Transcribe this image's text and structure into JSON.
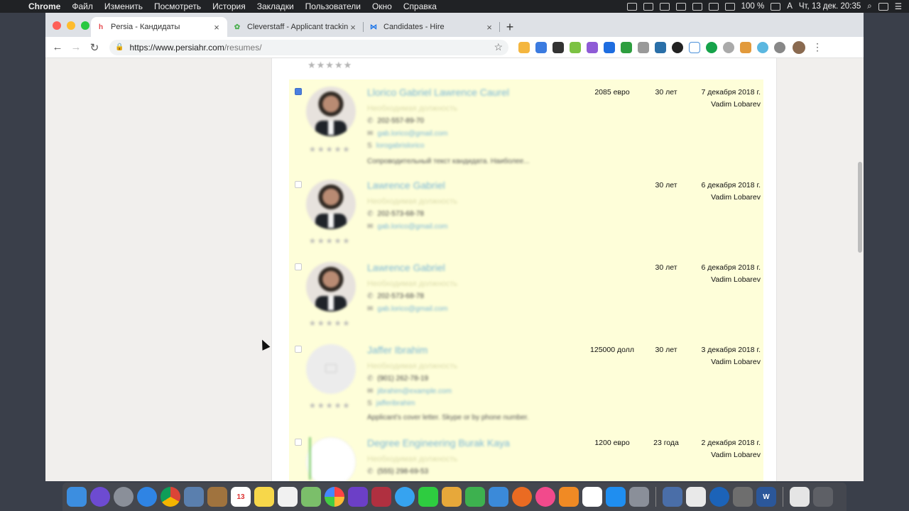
{
  "menubar": {
    "app": "Chrome",
    "items": [
      "Файл",
      "Изменить",
      "Посмотреть",
      "История",
      "Закладки",
      "Пользователи",
      "Окно",
      "Справка"
    ],
    "battery": "100 %",
    "input_lang": "A",
    "clock": "Чт, 13 дек.  20:35"
  },
  "tabs": [
    {
      "title": "Persia - Кандидаты",
      "favicon": "persia-logo-icon",
      "color": "#e5484d"
    },
    {
      "title": "Cleverstaff - Applicant tracking",
      "favicon": "cleverstaff-logo-icon",
      "color": "#4caf50"
    },
    {
      "title": "Candidates - Hire",
      "favicon": "hire-logo-icon",
      "color": "#1a73e8"
    }
  ],
  "address": {
    "url_host": "https://www.persiahr.com",
    "url_path": "/resumes/"
  },
  "candidates": [
    {
      "name": "Llorico Gabriel Lawrence Caurel",
      "position": "Необходимая должность",
      "phone": "202-557-89-70",
      "email": "gab.lorico@gmail.com",
      "link": "lorogabrislorico",
      "note": "Сопроводительный текст кандидата. Наиболее...",
      "salary": "2085 евро",
      "age": "30 лет",
      "date": "7 декабря 2018 г.",
      "author": "Vadim Lobarev",
      "checked": true,
      "photo": "portrait"
    },
    {
      "name": "Lawrence Gabriel",
      "position": "Необходимая должность",
      "phone": "202-573-68-78",
      "email": "gab.lorico@gmail.com",
      "link": "",
      "note": "",
      "salary": "",
      "age": "30 лет",
      "date": "6 декабря 2018 г.",
      "author": "Vadim Lobarev",
      "checked": false,
      "photo": "portrait"
    },
    {
      "name": "Lawrence Gabriel",
      "position": "Необходимая должность",
      "phone": "202-573-68-78",
      "email": "gab.lorico@gmail.com",
      "link": "",
      "note": "",
      "salary": "",
      "age": "30 лет",
      "date": "6 декабря 2018 г.",
      "author": "Vadim Lobarev",
      "checked": false,
      "photo": "portrait"
    },
    {
      "name": "Jaffer Ibrahim",
      "position": "Необходимая должность",
      "phone": "(901) 262-78-19",
      "email": "jibrahim@example.com",
      "link": "jafferibrahim",
      "note": "Applicant's cover letter. Skype or by phone number.",
      "salary": "125000 долл",
      "age": "30 лет",
      "date": "3 декабря 2018 г.",
      "author": "Vadim Lobarev",
      "checked": false,
      "photo": "empty"
    },
    {
      "name": "Degree Engineering Burak Kaya",
      "position": "Необходимая должность",
      "phone": "(555) 298-69-53",
      "email": "",
      "link": "",
      "note": "",
      "salary": "1200 евро",
      "age": "23 года",
      "date": "2 декабря 2018 г.",
      "author": "Vadim Lobarev",
      "checked": false,
      "photo": "white"
    }
  ],
  "colors": {
    "row_bg": "#fefed9",
    "link": "#7ab8d6",
    "accent_checkbox": "#4a7fe0"
  }
}
